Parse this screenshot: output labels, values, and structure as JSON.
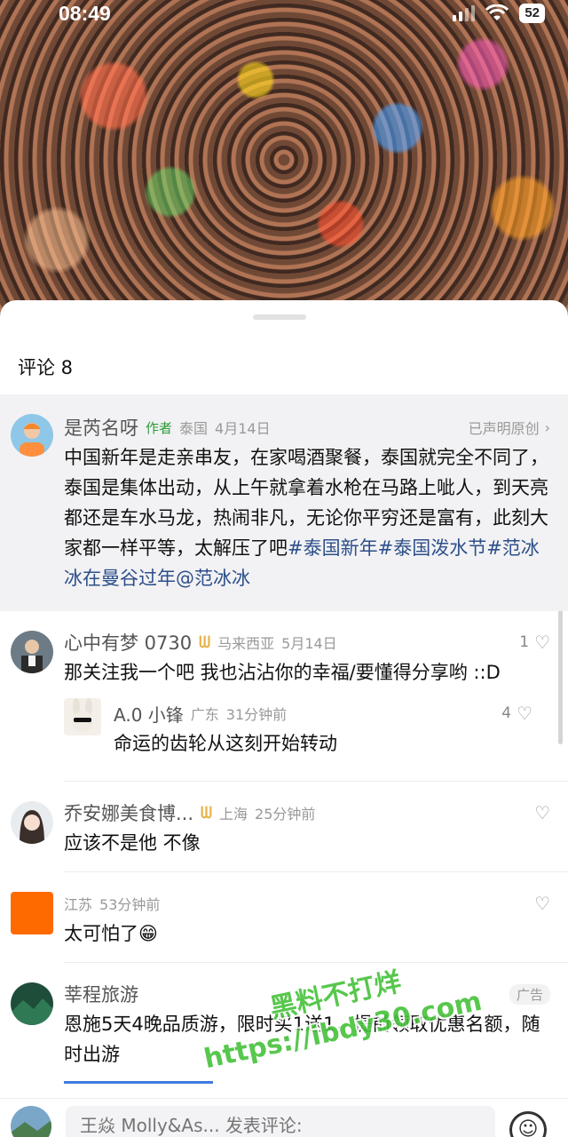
{
  "status_bar": {
    "time": "08:49",
    "battery": "52"
  },
  "sheet": {
    "title": "评论 8"
  },
  "comments": [
    {
      "user": "是芮名呀",
      "author_tag": "作者",
      "location": "泰国",
      "date": "4月14日",
      "original_label": "已声明原创",
      "text_parts": [
        "中国新年是走亲串友，在家喝酒聚餐，泰国就完全不同了，泰国是集体出动，从上午就拿着水枪在马路上呲人，到天亮都还是车水马龙，热闹非凡，无论你平穷还是富有，此刻大家都一样平等，太解压了吧",
        "#泰国新年#泰国泼水节#范冰冰在曼谷过年@范冰冰"
      ]
    },
    {
      "user": "心中有梦 0730",
      "location": "马来西亚",
      "date": "5月14日",
      "likes": "1",
      "text": "那关注我一个吧  我也沾沾你的幸福/要懂得分享哟 ::D",
      "reply": {
        "user": "A.0 小锋",
        "location": "广东",
        "date": "31分钟前",
        "likes": "4",
        "text": "命运的齿轮从这刻开始转动"
      }
    },
    {
      "user": "乔安娜美食博...",
      "location": "上海",
      "date": "25分钟前",
      "text": "应该不是他 不像"
    },
    {
      "user": "",
      "location": "江苏",
      "date": "53分钟前",
      "text": "太可怕了😁"
    },
    {
      "user": "莘程旅游",
      "ad_label": "广告",
      "text": "恩施5天4晚品质游，限时买1送1，提前领取优惠名额，随时出游"
    }
  ],
  "watermark": {
    "line1": "黑料不打烊",
    "line2": "https://ibdy30.com"
  },
  "input": {
    "placeholder": "王焱 Molly&As... 发表评论:"
  },
  "colors": {
    "hashtag": "#2d4f8a",
    "author_tag": "#2f9a3a",
    "crown": "#e8b34a"
  }
}
